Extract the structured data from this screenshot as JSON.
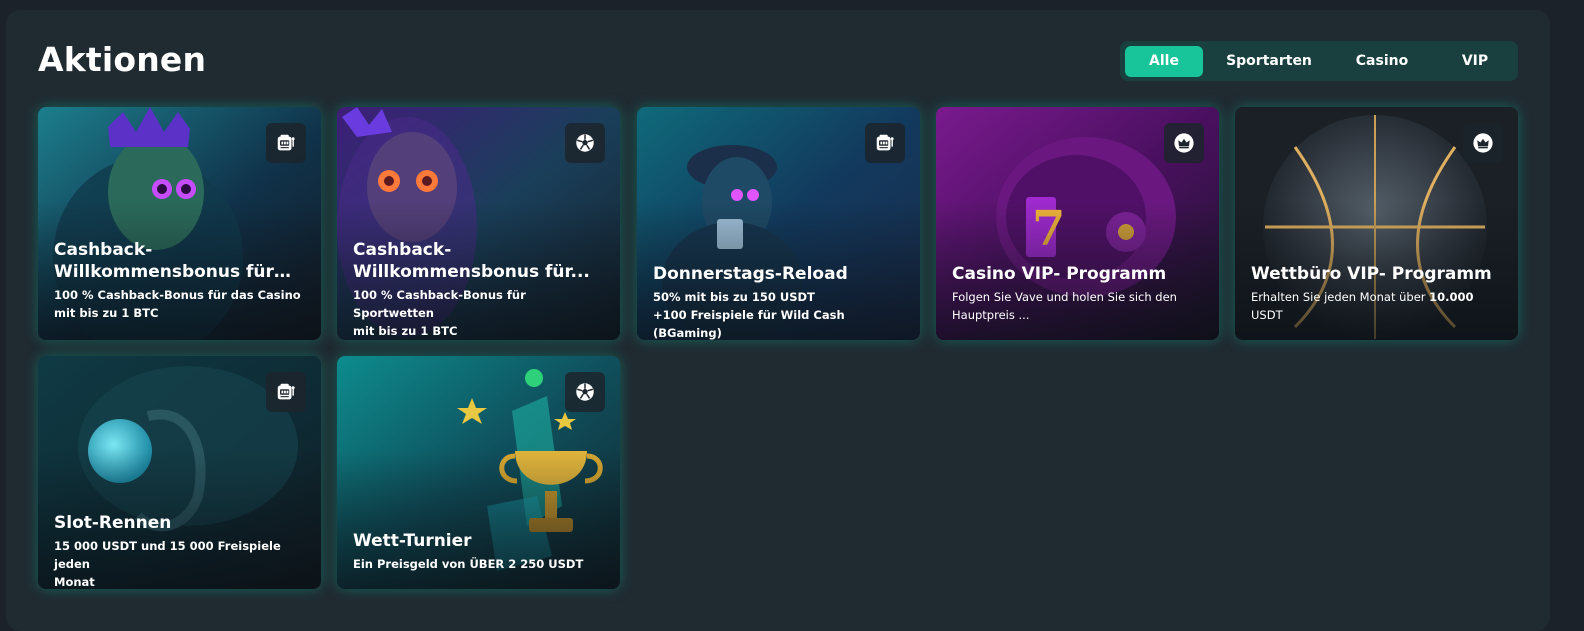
{
  "page_title": "Aktionen",
  "filter_tabs": [
    {
      "label": "Alle",
      "active": true
    },
    {
      "label": "Sportarten",
      "active": false
    },
    {
      "label": "Casino",
      "active": false
    },
    {
      "label": "VIP",
      "active": false
    }
  ],
  "colors": {
    "accent": "#18c59a",
    "tabs_bg": "#193f3f",
    "panel_bg": "#202a31",
    "page_bg": "#1b2229"
  },
  "promotions": [
    {
      "title": "Cashback-Willkommensbonus für da...",
      "description_line1": "100 % Cashback-Bonus für das Casino",
      "description_line2": "mit bis zu 1 BTC",
      "icon": "slot-machine-icon"
    },
    {
      "title": "Cashback-Willkommensbonus für...",
      "description_line1": "100 % Cashback-Bonus für Sportwetten",
      "description_line2": "mit bis zu 1 BTC",
      "icon": "soccer-ball-icon"
    },
    {
      "title": "Donnerstags-Reload",
      "description_line1": "50% mit bis zu 150 USDT",
      "description_line2": "+100 Freispiele für Wild Cash (BGaming)",
      "icon": "slot-machine-icon"
    },
    {
      "title": "Casino VIP- Programm",
      "description_line1": "Folgen Sie Vave und holen Sie sich den",
      "description_line2": "Hauptpreis ...",
      "icon": "crown-icon"
    },
    {
      "title": "Wettbüro VIP- Programm",
      "description_line1_prefix": "Erhalten Sie jeden Monat über ",
      "description_line1_highlight": "10.000",
      "description_line2": "USDT",
      "icon": "crown-icon"
    },
    {
      "title": "Slot-Rennen",
      "description_line1": "15 000 USDT und 15 000 Freispiele jeden",
      "description_line2": "Monat",
      "icon": "slot-machine-icon"
    },
    {
      "title": "Wett-Turnier",
      "description_line1": "Ein Preisgeld von ÜBER 2 250 USDT",
      "icon": "soccer-ball-icon"
    }
  ]
}
